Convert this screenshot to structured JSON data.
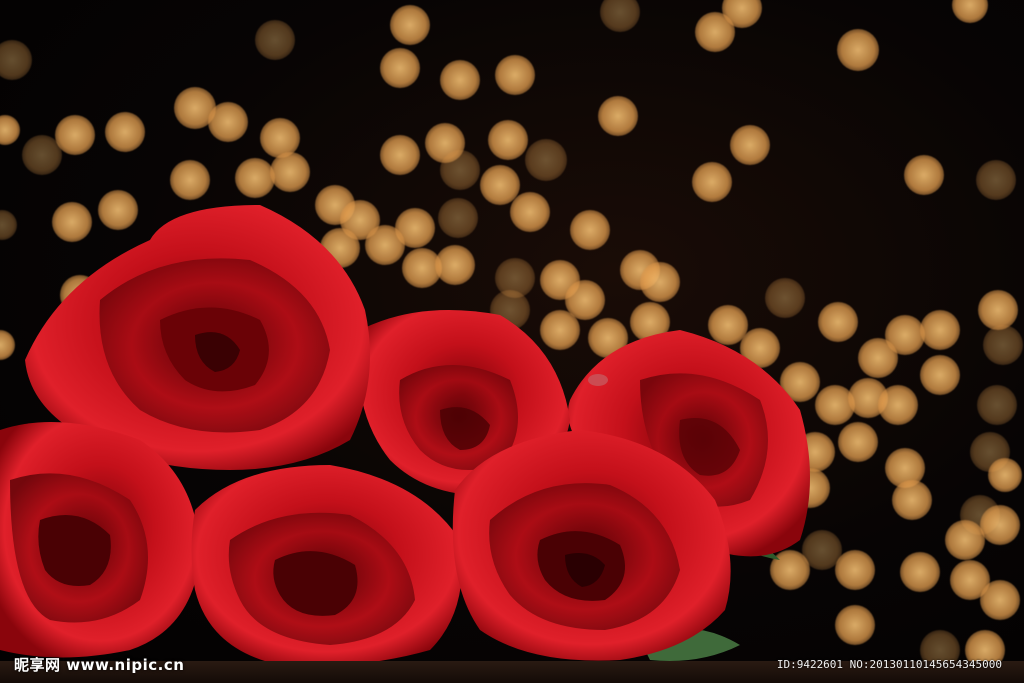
{
  "image": {
    "subject": "red-roses-bouquet",
    "background": "bokeh-lights",
    "colors": {
      "rose_red": "#c4101a",
      "rose_dark": "#6a0206",
      "bokeh_gold": "#e8a85a",
      "background": "#050303"
    }
  },
  "watermark": {
    "site_logo_text": "昵享网",
    "site_url": "www.nipic.cn",
    "id_text": "ID:9422601 NO:20130110145654345000"
  }
}
